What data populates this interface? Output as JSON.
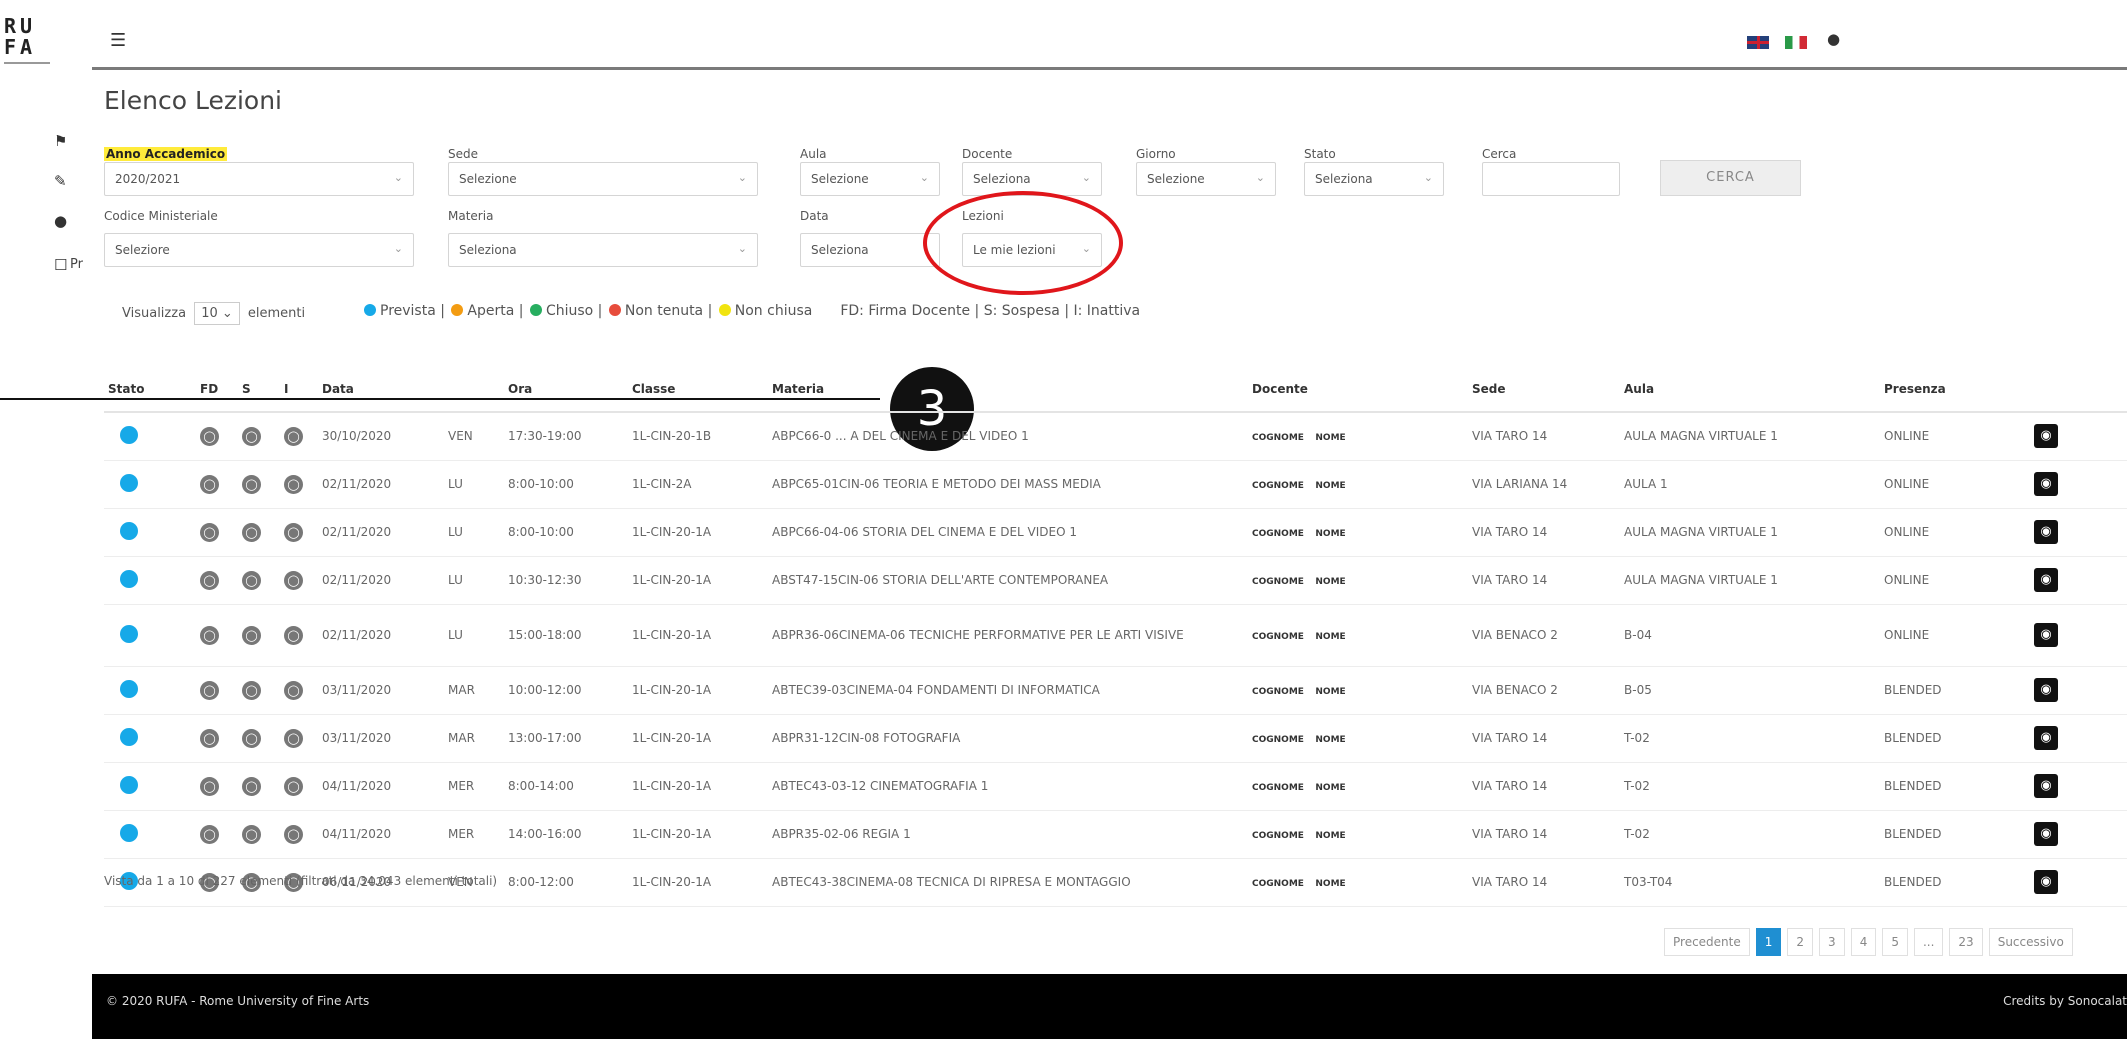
{
  "brand": {
    "logo_line1": "RU",
    "logo_line2": "FA"
  },
  "rail": {
    "extra_label": "Pr"
  },
  "header": {
    "menu_icon": "hamburger-icon",
    "flags": [
      "uk-flag",
      "italy-flag"
    ],
    "user_icon": "user-icon"
  },
  "page": {
    "title": "Elenco Lezioni"
  },
  "filters": {
    "anno": {
      "label": "Anno Accademico",
      "value": "2020/2021"
    },
    "sede": {
      "label": "Sede",
      "value": "Selezione"
    },
    "aula": {
      "label": "Aula",
      "value": "Selezione"
    },
    "docente": {
      "label": "Docente",
      "value": "Seleziona"
    },
    "giorno": {
      "label": "Giorno",
      "value": "Selezione"
    },
    "stato": {
      "label": "Stato",
      "value": "Seleziona"
    },
    "cerca": {
      "label": "Cerca",
      "value": ""
    },
    "cerca_button": "CERCA",
    "codice": {
      "label": "Codice Ministeriale",
      "value": "Seleziore"
    },
    "materia": {
      "label": "Materia",
      "value": "Seleziona"
    },
    "data": {
      "label": "Data",
      "value": "Seleziona"
    },
    "lezioni": {
      "label": "Lezioni",
      "value": "Le mie lezioni"
    }
  },
  "show": {
    "prefix": "Visualizza",
    "length": "10",
    "suffix": "elementi"
  },
  "legend": {
    "items": [
      {
        "label": "Prevista",
        "color": "#16a9e8"
      },
      {
        "label": "Aperta",
        "color": "#f39c12"
      },
      {
        "label": "Chiuso",
        "color": "#27ae60"
      },
      {
        "label": "Non tenuta",
        "color": "#e74c3c"
      },
      {
        "label": "Non chiusa",
        "color": "#f1e40f"
      }
    ],
    "note": "FD: Firma Docente | S: Sospesa | I: Inattiva"
  },
  "annotation": {
    "number": "3"
  },
  "table": {
    "headers": [
      "Stato",
      "FD",
      "S",
      "I",
      "Data",
      "",
      "Ora",
      "Classe",
      "Materia",
      "Docente",
      "Sede",
      "Aula",
      "Presenza"
    ],
    "rows": [
      {
        "data": "30/10/2020",
        "day": "VEN",
        "ora": "17:30-19:00",
        "classe": "1L-CIN-20-1B",
        "materia": "ABPC66-0 ... A DEL CINEMA E DEL VIDEO 1",
        "cognome": "COGNOME",
        "nome": "NOME",
        "sede": "VIA TARO 14",
        "aula": "AULA MAGNA VIRTUALE 1",
        "presenza": "ONLINE"
      },
      {
        "data": "02/11/2020",
        "day": "LU",
        "ora": "8:00-10:00",
        "classe": "1L-CIN-2A",
        "materia": "ABPC65-01CIN-06 TEORIA E METODO DEI MASS MEDIA",
        "cognome": "COGNOME",
        "nome": "NOME",
        "sede": "VIA LARIANA 14",
        "aula": "AULA 1",
        "presenza": "ONLINE"
      },
      {
        "data": "02/11/2020",
        "day": "LU",
        "ora": "8:00-10:00",
        "classe": "1L-CIN-20-1A",
        "materia": "ABPC66-04-06 STORIA DEL CINEMA E DEL VIDEO 1",
        "cognome": "COGNOME",
        "nome": "NOME",
        "sede": "VIA TARO 14",
        "aula": "AULA MAGNA VIRTUALE 1",
        "presenza": "ONLINE"
      },
      {
        "data": "02/11/2020",
        "day": "LU",
        "ora": "10:30-12:30",
        "classe": "1L-CIN-20-1A",
        "materia": "ABST47-15CIN-06 STORIA DELL'ARTE CONTEMPORANEA",
        "cognome": "COGNOME",
        "nome": "NOME",
        "sede": "VIA TARO 14",
        "aula": "AULA MAGNA VIRTUALE 1",
        "presenza": "ONLINE"
      },
      {
        "data": "02/11/2020",
        "day": "LU",
        "ora": "15:00-18:00",
        "classe": "1L-CIN-20-1A",
        "materia": "ABPR36-06CINEMA-06 TECNICHE PERFORMATIVE PER LE ARTI VISIVE",
        "cognome": "COGNOME",
        "nome": "NOME",
        "sede": "VIA BENACO 2",
        "aula": "B-04",
        "presenza": "ONLINE",
        "tall": true
      },
      {
        "data": "03/11/2020",
        "day": "MAR",
        "ora": "10:00-12:00",
        "classe": "1L-CIN-20-1A",
        "materia": "ABTEC39-03CINEMA-04 FONDAMENTI DI INFORMATICA",
        "cognome": "COGNOME",
        "nome": "NOME",
        "sede": "VIA BENACO 2",
        "aula": "B-05",
        "presenza": "BLENDED"
      },
      {
        "data": "03/11/2020",
        "day": "MAR",
        "ora": "13:00-17:00",
        "classe": "1L-CIN-20-1A",
        "materia": "ABPR31-12CIN-08 FOTOGRAFIA",
        "cognome": "COGNOME",
        "nome": "NOME",
        "sede": "VIA TARO 14",
        "aula": "T-02",
        "presenza": "BLENDED"
      },
      {
        "data": "04/11/2020",
        "day": "MER",
        "ora": "8:00-14:00",
        "classe": "1L-CIN-20-1A",
        "materia": "ABTEC43-03-12 CINEMATOGRAFIA 1",
        "cognome": "COGNOME",
        "nome": "NOME",
        "sede": "VIA TARO 14",
        "aula": "T-02",
        "presenza": "BLENDED"
      },
      {
        "data": "04/11/2020",
        "day": "MER",
        "ora": "14:00-16:00",
        "classe": "1L-CIN-20-1A",
        "materia": "ABPR35-02-06 REGIA 1",
        "cognome": "COGNOME",
        "nome": "NOME",
        "sede": "VIA TARO 14",
        "aula": "T-02",
        "presenza": "BLENDED"
      },
      {
        "data": "06/11/2020",
        "day": "VEN",
        "ora": "8:00-12:00",
        "classe": "1L-CIN-20-1A",
        "materia": "ABTEC43-38CINEMA-08 TECNICA DI RIPRESA E MONTAGGIO",
        "cognome": "COGNOME",
        "nome": "NOME",
        "sede": "VIA TARO 14",
        "aula": "T03-T04",
        "presenza": "BLENDED"
      }
    ]
  },
  "info": "Vista da 1 a 10 di 227 elementi (filtrati da 34.043 elementi totali)",
  "pager": {
    "prev": "Precedente",
    "pages": [
      "1",
      "2",
      "3",
      "4",
      "5",
      "...",
      "23"
    ],
    "next": "Successivo"
  },
  "footer": {
    "left": "© 2020 RUFA - Rome University of Fine Arts",
    "right": "Credits by Sonocalat"
  }
}
